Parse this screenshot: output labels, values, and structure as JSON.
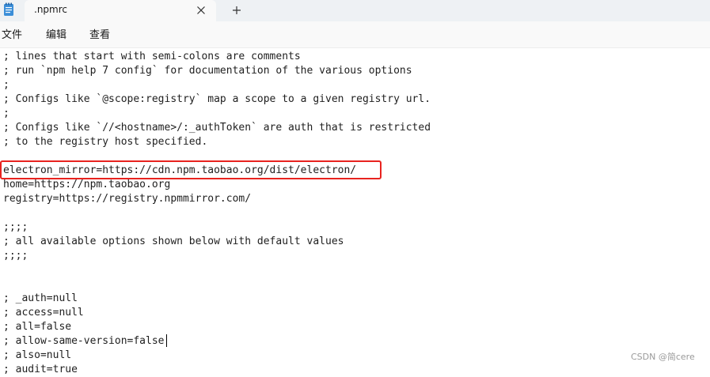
{
  "window": {
    "tab_title": ".npmrc",
    "app_icon": "notepad-icon",
    "close_icon": "close-icon",
    "new_tab_icon": "plus-icon"
  },
  "menu": {
    "file": "文件",
    "edit": "编辑",
    "view": "查看"
  },
  "editor": {
    "lines": [
      "; lines that start with semi-colons are comments",
      "; run `npm help 7 config` for documentation of the various options",
      ";",
      "; Configs like `@scope:registry` map a scope to a given registry url.",
      ";",
      "; Configs like `//<hostname>/:_authToken` are auth that is restricted",
      "; to the registry host specified.",
      "",
      "electron_mirror=https://cdn.npm.taobao.org/dist/electron/",
      "home=https://npm.taobao.org",
      "registry=https://registry.npmmirror.com/",
      "",
      ";;;;",
      "; all available options shown below with default values",
      ";;;;",
      "",
      "",
      "; _auth=null",
      "; access=null",
      "; all=false",
      "; allow-same-version=false",
      "; also=null",
      "; audit=true"
    ]
  },
  "watermark": "CSDN @简cere",
  "colors": {
    "highlight": "#e8231f",
    "tabbar_bg": "#eef1f4",
    "tab_bg": "#f9f9f9"
  }
}
